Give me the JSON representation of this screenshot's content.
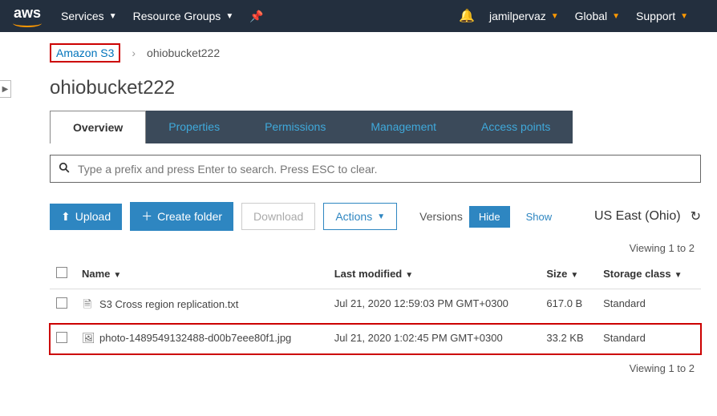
{
  "topnav": {
    "logo": "aws",
    "services": "Services",
    "resource_groups": "Resource Groups",
    "user": "jamilpervaz",
    "region_nav": "Global",
    "support": "Support"
  },
  "breadcrumb": {
    "root": "Amazon S3",
    "current": "ohiobucket222"
  },
  "title": "ohiobucket222",
  "tabs": {
    "overview": "Overview",
    "properties": "Properties",
    "permissions": "Permissions",
    "management": "Management",
    "access_points": "Access points"
  },
  "search": {
    "placeholder": "Type a prefix and press Enter to search. Press ESC to clear."
  },
  "toolbar": {
    "upload": "Upload",
    "create_folder": "Create folder",
    "download": "Download",
    "actions": "Actions",
    "versions": "Versions",
    "hide": "Hide",
    "show": "Show",
    "region": "US East (Ohio)"
  },
  "paging": {
    "top": "Viewing 1 to 2",
    "bottom": "Viewing 1 to 2"
  },
  "columns": {
    "name": "Name",
    "last_modified": "Last modified",
    "size": "Size",
    "storage_class": "Storage class"
  },
  "rows": [
    {
      "icon": "file-text",
      "name": "S3 Cross region replication.txt",
      "last_modified": "Jul 21, 2020 12:59:03 PM GMT+0300",
      "size": "617.0 B",
      "storage_class": "Standard",
      "highlight": false
    },
    {
      "icon": "file-image",
      "name": "photo-1489549132488-d00b7eee80f1.jpg",
      "last_modified": "Jul 21, 2020 1:02:45 PM GMT+0300",
      "size": "33.2 KB",
      "storage_class": "Standard",
      "highlight": true
    }
  ]
}
